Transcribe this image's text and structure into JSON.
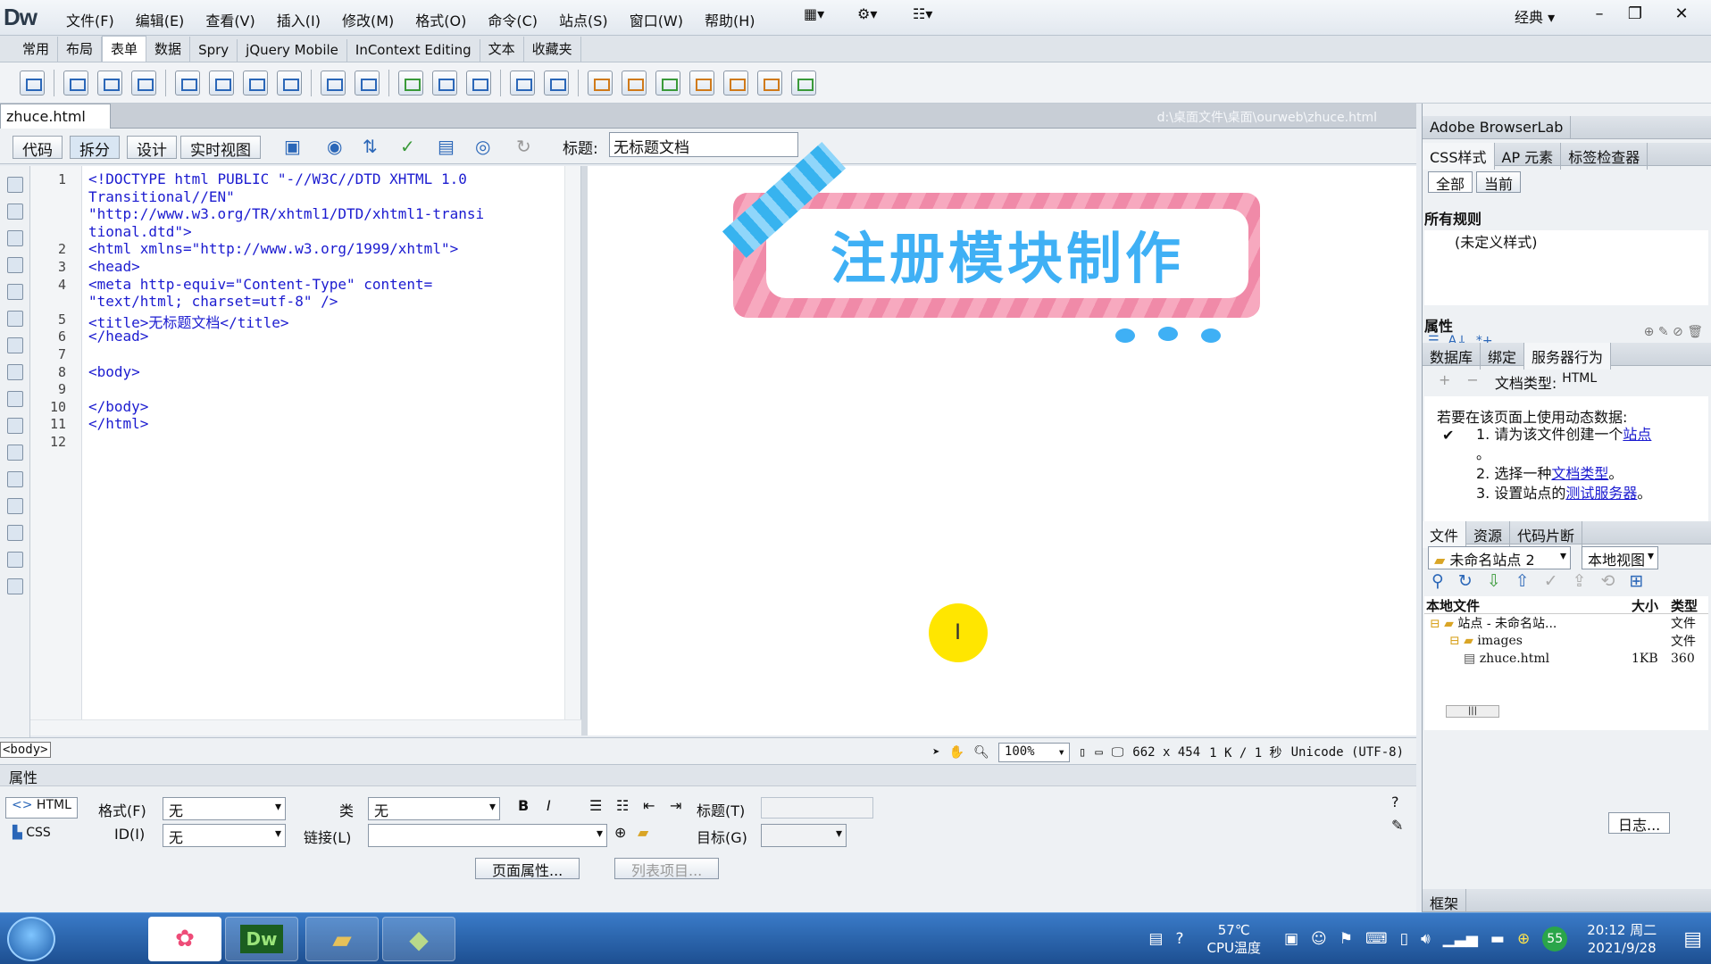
{
  "app": {
    "logo": "Dw",
    "workspace": "经典"
  },
  "menu": [
    "文件(F)",
    "编辑(E)",
    "查看(V)",
    "插入(I)",
    "修改(M)",
    "格式(O)",
    "命令(C)",
    "站点(S)",
    "窗口(W)",
    "帮助(H)"
  ],
  "insert_tabs": [
    "常用",
    "布局",
    "表单",
    "数据",
    "Spry",
    "jQuery Mobile",
    "InContext Editing",
    "文本",
    "收藏夹"
  ],
  "insert_active": "表单",
  "document": {
    "tab": "zhuce.html",
    "path": "d:\\桌面文件\\桌面\\ourweb\\zhuce.html",
    "views": [
      "代码",
      "拆分",
      "设计",
      "实时视图"
    ],
    "active_view": "拆分",
    "title_label": "标题:",
    "title_value": "无标题文档"
  },
  "code_lines": [
    {
      "n": "1",
      "t": "<!DOCTYPE html PUBLIC \"-//W3C//DTD XHTML 1.0"
    },
    {
      "n": "",
      "t": "Transitional//EN\""
    },
    {
      "n": "",
      "t": "\"http://www.w3.org/TR/xhtml1/DTD/xhtml1-transi"
    },
    {
      "n": "",
      "t": "tional.dtd\">"
    },
    {
      "n": "2",
      "t": "<html xmlns=\"http://www.w3.org/1999/xhtml\">"
    },
    {
      "n": "3",
      "t": "<head>"
    },
    {
      "n": "4",
      "t": "<meta http-equiv=\"Content-Type\" content="
    },
    {
      "n": "",
      "t": "\"text/html; charset=utf-8\" />"
    },
    {
      "n": "5",
      "t": "<title>无标题文档</title>"
    },
    {
      "n": "6",
      "t": "</head>"
    },
    {
      "n": "7",
      "t": ""
    },
    {
      "n": "8",
      "t": "<body>"
    },
    {
      "n": "9",
      "t": ""
    },
    {
      "n": "10",
      "t": "</body>"
    },
    {
      "n": "11",
      "t": "</html>"
    },
    {
      "n": "12",
      "t": ""
    }
  ],
  "design": {
    "banner_text": "注册模块制作",
    "cursor_glyph": "I"
  },
  "status": {
    "tag": "<body>",
    "zoom": "100%",
    "size": "662 x 454",
    "speed": "1 K / 1 秒",
    "encoding": "Unicode (UTF-8)"
  },
  "properties": {
    "header": "属性",
    "html_btn": "HTML",
    "css_btn": "CSS",
    "format_label": "格式(F)",
    "format_value": "无",
    "class_label": "类",
    "class_value": "无",
    "id_label": "ID(I)",
    "id_value": "无",
    "link_label": "链接(L)",
    "title_label": "标题(T)",
    "target_label": "目标(G)",
    "page_props_btn": "页面属性...",
    "list_item_btn": "列表项目...",
    "bold": "B",
    "italic": "I"
  },
  "right": {
    "browserlab": "Adobe BrowserLab",
    "css_tabs": [
      "CSS样式",
      "AP 元素",
      "标签检查器"
    ],
    "css_toggle": [
      "全部",
      "当前"
    ],
    "all_rules_title": "所有规则",
    "undefined_style": "(未定义样式)",
    "props_title": "属性",
    "server_tabs": [
      "数据库",
      "绑定",
      "服务器行为"
    ],
    "doc_type_label": "文档类型:",
    "doc_type_value": "HTML",
    "dyn_intro": "若要在该页面上使用动态数据:",
    "steps": [
      {
        "pre": "1. 请为该文件创建一个",
        "link": "站点",
        "post": ""
      },
      {
        "pre": "",
        "link": "",
        "post": "。"
      },
      {
        "pre": "2. 选择一种",
        "link": "文档类型",
        "post": "。"
      },
      {
        "pre": "3. 设置站点的",
        "link": "测试服务器",
        "post": "。"
      }
    ],
    "files_tabs": [
      "文件",
      "资源",
      "代码片断"
    ],
    "site_select": "未命名站点 2",
    "view_select": "本地视图",
    "files_cols": [
      "本地文件",
      "大小",
      "类型"
    ],
    "tree": [
      {
        "name": "站点 - 未命名站...",
        "size": "",
        "type": "文件"
      },
      {
        "name": "images",
        "size": "",
        "type": "文件"
      },
      {
        "name": "zhuce.html",
        "size": "1KB",
        "type": "360"
      }
    ],
    "log_btn": "日志...",
    "frames": "框架"
  },
  "taskbar": {
    "temp": "57℃",
    "temp_label": "CPU温度",
    "time": "20:12 周二",
    "date": "2021/9/28",
    "badge": "55"
  }
}
